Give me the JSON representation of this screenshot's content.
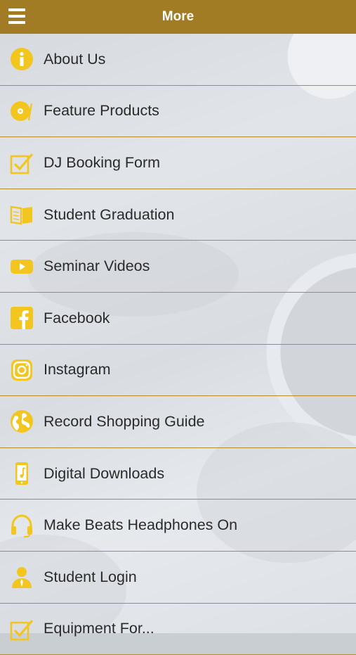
{
  "header": {
    "title": "More",
    "menu_icon": "hamburger-icon"
  },
  "colors": {
    "header_bg": "#a17c24",
    "accent": "#f3c51f",
    "divider": "#b28d2c"
  },
  "menu": [
    {
      "label": "About Us",
      "icon": "info-icon"
    },
    {
      "label": "Feature Products",
      "icon": "vinyl-record-icon"
    },
    {
      "label": "DJ Booking Form",
      "icon": "checkbox-icon"
    },
    {
      "label": "Student Graduation",
      "icon": "open-book-icon"
    },
    {
      "label": "Seminar Videos",
      "icon": "youtube-icon"
    },
    {
      "label": "Facebook",
      "icon": "facebook-icon"
    },
    {
      "label": "Instagram",
      "icon": "instagram-icon"
    },
    {
      "label": "Record Shopping Guide",
      "icon": "globe-icon"
    },
    {
      "label": "Digital Downloads",
      "icon": "phone-music-icon"
    },
    {
      "label": "Make Beats Headphones On",
      "icon": "headphones-icon"
    },
    {
      "label": "Student Login",
      "icon": "user-icon"
    },
    {
      "label": "Equipment For...",
      "icon": "checkbox-icon"
    }
  ]
}
